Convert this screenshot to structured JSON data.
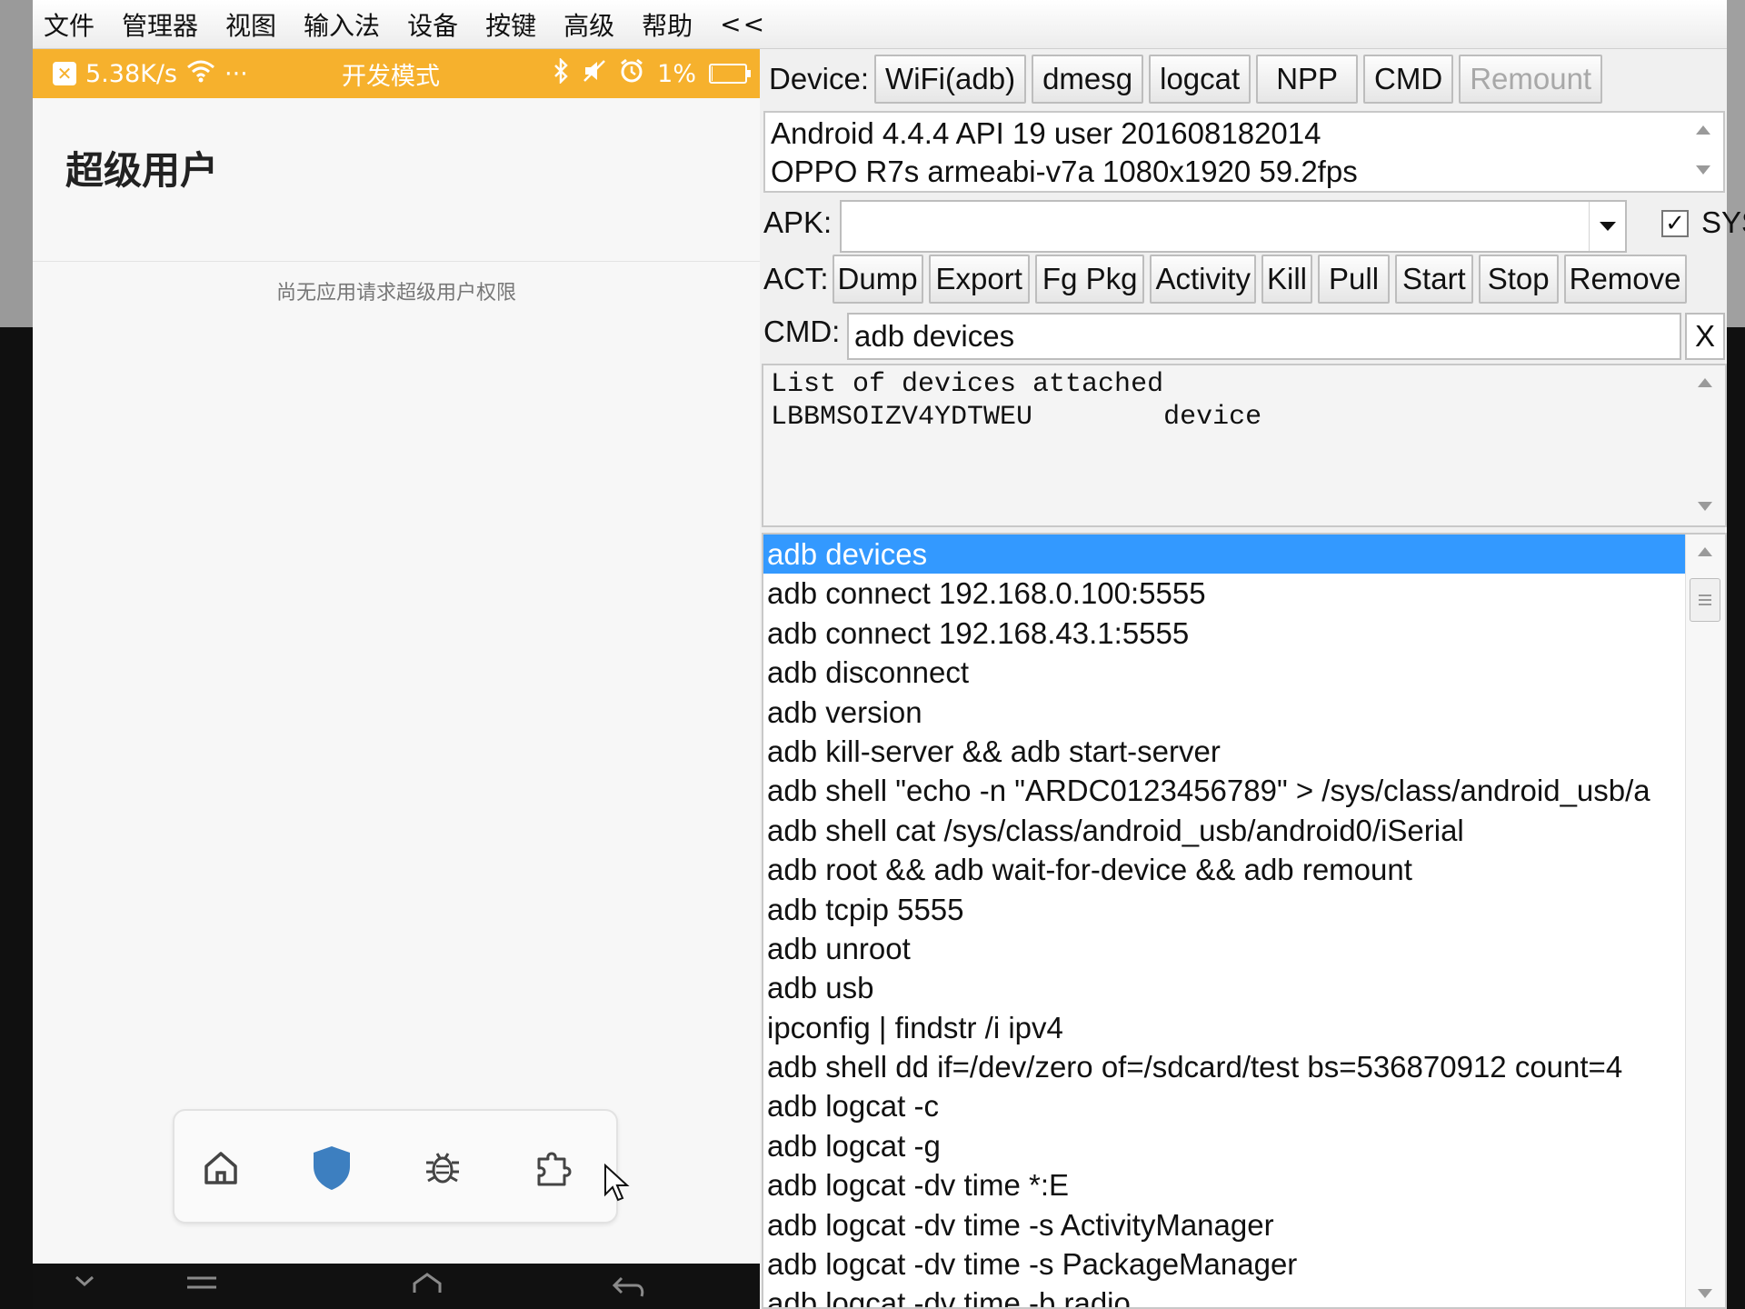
{
  "menubar": {
    "items": [
      "文件",
      "管理器",
      "视图",
      "输入法",
      "设备",
      "按键",
      "高级",
      "帮助"
    ],
    "collapse": "<<"
  },
  "phone": {
    "status": {
      "speed": "5.38K/s",
      "dots": "···",
      "mode": "开发模式",
      "battery": "1%",
      "battery_level": 0.01
    },
    "title": "超级用户",
    "empty_message": "尚无应用请求超级用户权限",
    "bottom_nav": [
      "home-icon",
      "shield-icon",
      "bug-icon",
      "puzzle-icon"
    ],
    "accent": "#f6b12d",
    "active_nav": "#3d7fc0"
  },
  "tools": {
    "device_label": "Device:",
    "device_buttons": [
      {
        "label": "WiFi(adb)",
        "enabled": true
      },
      {
        "label": "dmesg",
        "enabled": true
      },
      {
        "label": "logcat",
        "enabled": true
      },
      {
        "label": "NPP",
        "enabled": true
      },
      {
        "label": "CMD",
        "enabled": true
      },
      {
        "label": "Remount",
        "enabled": false
      }
    ],
    "info": {
      "line1": "Android 4.4.4 API 19 user 201608182014",
      "line2": "OPPO R7s  armeabi-v7a 1080x1920 59.2fps"
    },
    "apk_label": "APK:",
    "apk_value": "",
    "sys_label": "SYS",
    "sys_checked": "✓",
    "act_label": "ACT:",
    "act_buttons": [
      "Dump",
      "Export",
      "Fg Pkg",
      "Activity",
      "Kill",
      "Pull",
      "Start",
      "Stop",
      "Remove"
    ],
    "cmd_label": "CMD:",
    "cmd_value": "adb devices",
    "clear_label": "X",
    "output": {
      "line1": "List of devices attached",
      "line2": "LBBMSOIZV4YDTWEU        device"
    },
    "selection_color": "#3399ff",
    "commands": [
      "adb devices",
      "adb connect 192.168.0.100:5555",
      "adb connect 192.168.43.1:5555",
      "adb disconnect",
      "adb version",
      "adb kill-server && adb start-server",
      "adb shell \"echo -n \"ARDC0123456789\" > /sys/class/android_usb/a",
      "adb shell cat /sys/class/android_usb/android0/iSerial",
      "adb root && adb wait-for-device && adb remount",
      "adb tcpip 5555",
      "adb unroot",
      "adb usb",
      "ipconfig | findstr /i ipv4",
      "adb shell dd if=/dev/zero of=/sdcard/test bs=536870912 count=4",
      "adb logcat -c",
      "adb logcat -g",
      "adb logcat -dv time *:E",
      "adb logcat -dv time -s ActivityManager",
      "adb logcat -dv time -s PackageManager",
      "adb logcat -dv time -b radio"
    ]
  }
}
